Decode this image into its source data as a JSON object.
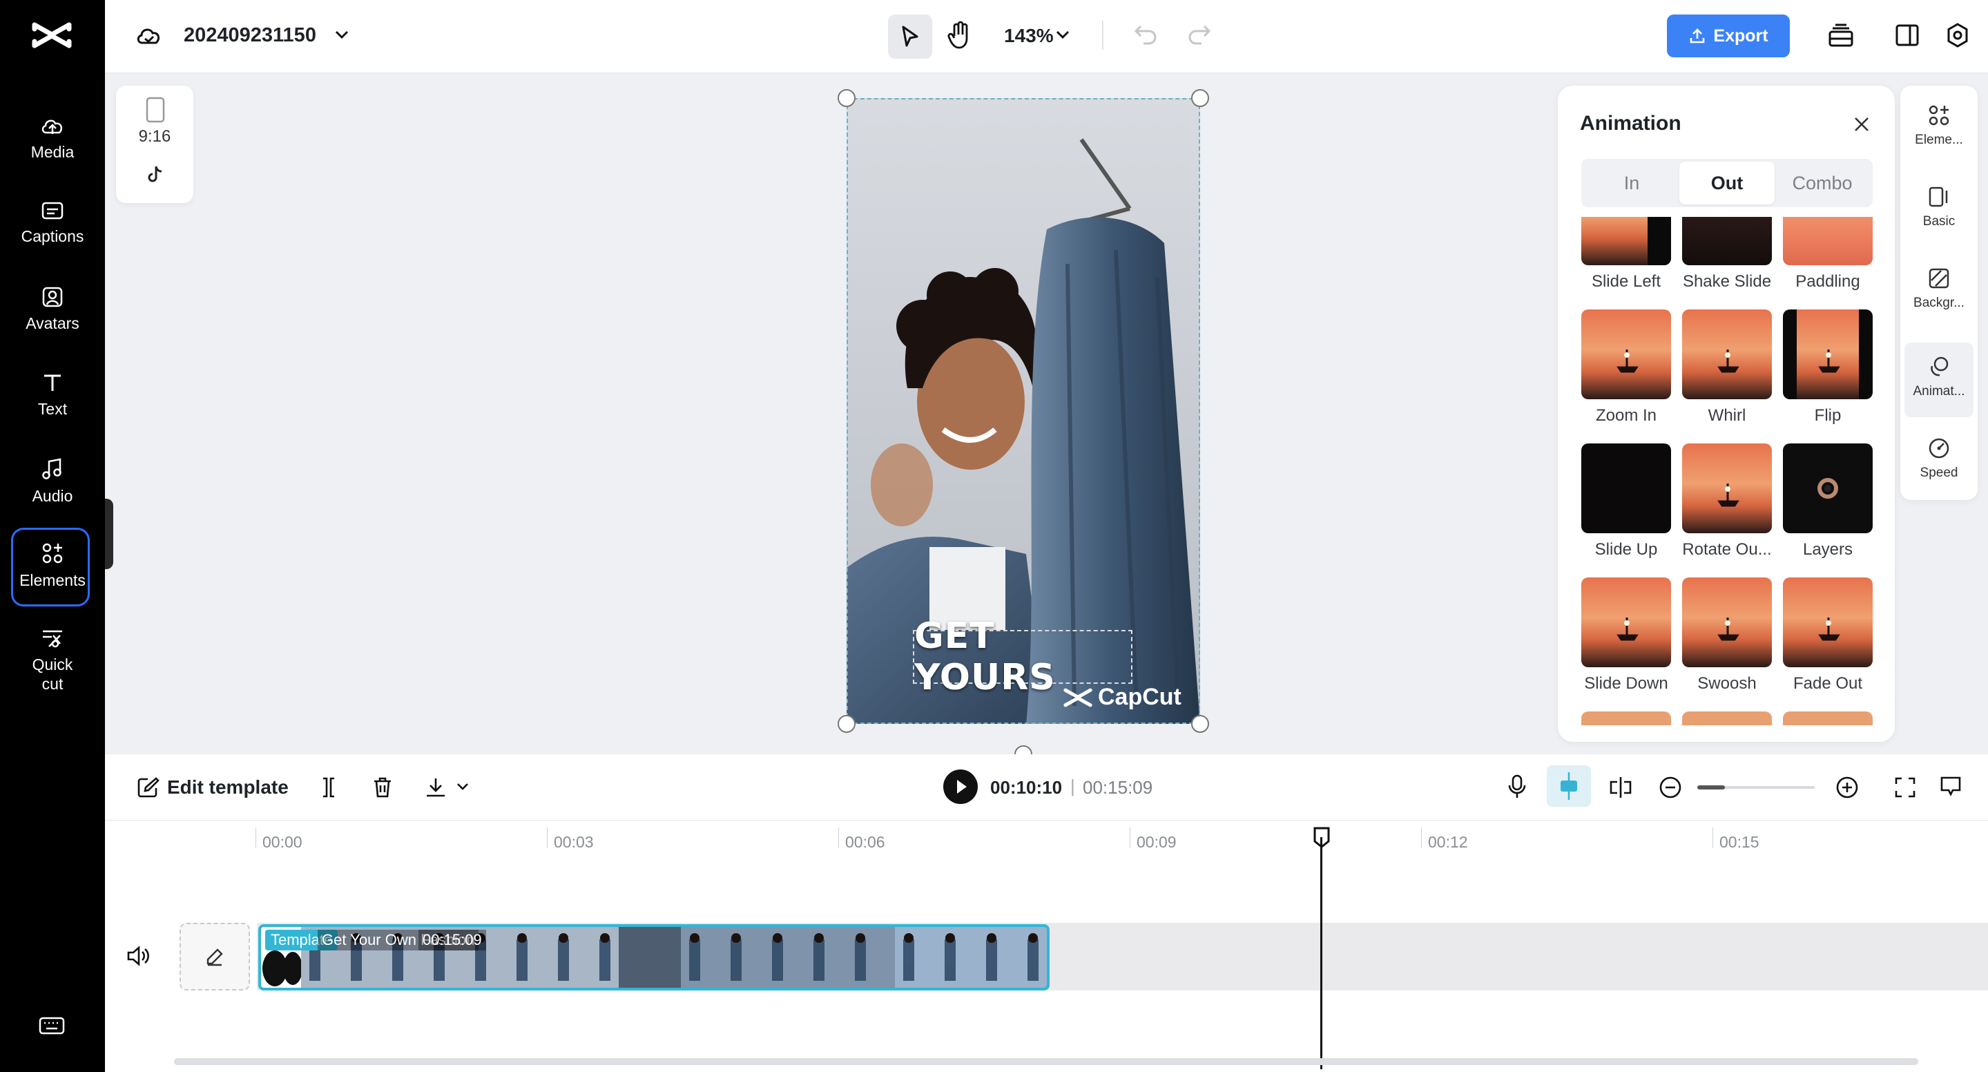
{
  "app": {
    "brand": "CapCut"
  },
  "nav": {
    "items": [
      {
        "label": "Media",
        "icon": "cloud-upload-icon"
      },
      {
        "label": "Captions",
        "icon": "captions-icon"
      },
      {
        "label": "Avatars",
        "icon": "avatar-icon"
      },
      {
        "label": "Text",
        "icon": "text-icon"
      },
      {
        "label": "Audio",
        "icon": "music-note-icon"
      },
      {
        "label": "Elements",
        "icon": "elements-icon",
        "active": true
      },
      {
        "label": "Quick\ncut",
        "icon": "quick-cut-icon"
      }
    ]
  },
  "topbar": {
    "project_name": "202409231150",
    "zoom": "143%",
    "export_label": "Export",
    "accent": "#3b82f6"
  },
  "canvas": {
    "ratio": "9:16",
    "caption": "GET YOURS",
    "watermark": "CapCut"
  },
  "animation_panel": {
    "title": "Animation",
    "tabs": [
      "In",
      "Out",
      "Combo"
    ],
    "active_tab": "Out",
    "items": [
      {
        "label": "Slide Left",
        "style": "sunset-cut"
      },
      {
        "label": "Shake Slide",
        "style": "dark"
      },
      {
        "label": "Paddling",
        "style": "sunset-bright"
      },
      {
        "label": "Zoom In",
        "style": "sunset"
      },
      {
        "label": "Whirl",
        "style": "sunset"
      },
      {
        "label": "Flip",
        "style": "sunset-narrow"
      },
      {
        "label": "Slide Up",
        "style": "black"
      },
      {
        "label": "Rotate Ou...",
        "style": "sunset"
      },
      {
        "label": "Layers",
        "style": "ring"
      },
      {
        "label": "Slide Down",
        "style": "sunset"
      },
      {
        "label": "Swoosh",
        "style": "sunset"
      },
      {
        "label": "Fade Out",
        "style": "sunset"
      }
    ]
  },
  "right_rail": {
    "items": [
      {
        "label": "Eleme...",
        "icon": "elements-icon"
      },
      {
        "label": "Basic",
        "icon": "basic-icon"
      },
      {
        "label": "Backgr...",
        "icon": "background-icon"
      },
      {
        "label": "Animat...",
        "icon": "animation-icon",
        "active": true
      },
      {
        "label": "Speed",
        "icon": "speed-icon"
      }
    ]
  },
  "timeline_toolbar": {
    "edit_template_label": "Edit template",
    "current_time": "00:10:10",
    "separator": "|",
    "total_time": "00:15:09"
  },
  "timeline": {
    "ticks": [
      "00:00",
      "00:03",
      "00:06",
      "00:09",
      "00:12",
      "00:15"
    ],
    "clip": {
      "tag": "Template",
      "title": "Get Your Own Fashion",
      "duration": "00:15:09"
    }
  }
}
